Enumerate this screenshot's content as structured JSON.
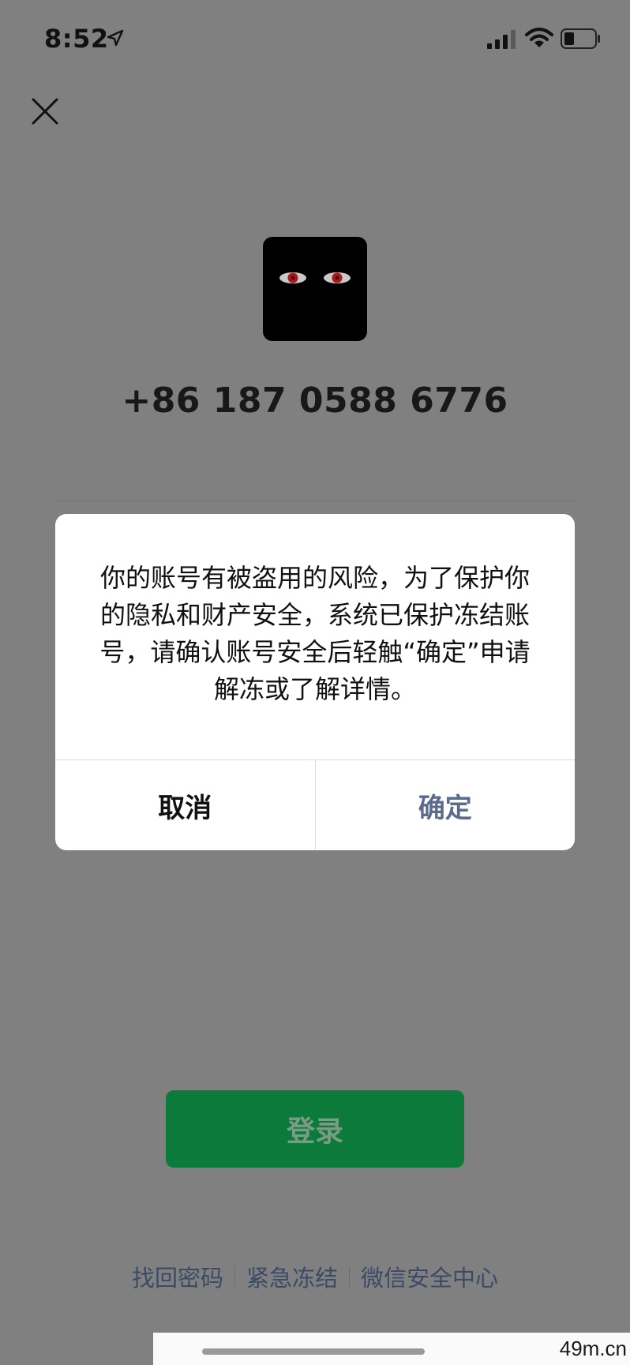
{
  "status_bar": {
    "time": "8:52"
  },
  "account": {
    "phone_number": "+86 187 0588 6776"
  },
  "dialog": {
    "message": "你的账号有被盗用的风险，为了保护你的隐私和财产安全，系统已保护冻结账号，请确认账号安全后轻触“确定”申请解冻或了解详情。",
    "cancel_label": "取消",
    "confirm_label": "确定"
  },
  "login": {
    "button_label": "登录"
  },
  "footer": {
    "links": [
      "找回密码",
      "紧急冻结",
      "微信安全中心"
    ]
  },
  "watermark": "49m.cn",
  "colors": {
    "overlay_background": "#808080",
    "login_green": "#0b7a3b",
    "confirm_text": "#5b6b8c"
  }
}
